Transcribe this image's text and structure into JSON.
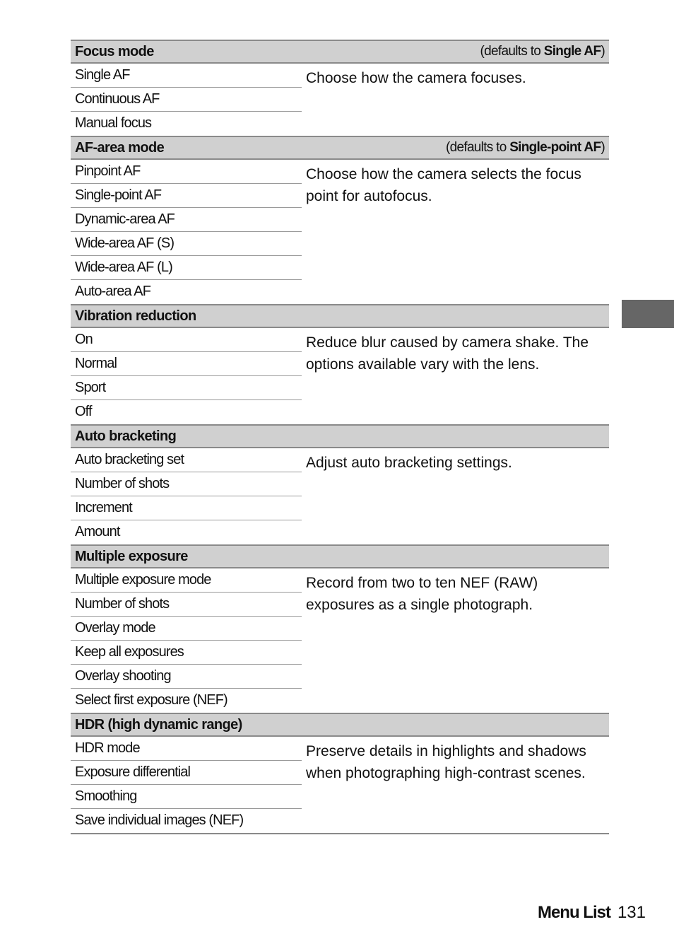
{
  "sections": [
    {
      "title": "Focus mode",
      "default_prefix": "(defaults to ",
      "default_value": "Single AF",
      "default_suffix": ")",
      "options": [
        "Single AF",
        "Continuous AF",
        "Manual focus"
      ],
      "description": "Choose how the camera focuses."
    },
    {
      "title": "AF-area mode",
      "default_prefix": "(defaults to ",
      "default_value": "Single-point AF",
      "default_suffix": ")",
      "options": [
        "Pinpoint AF",
        "Single-point AF",
        "Dynamic-area AF",
        "Wide-area AF (S)",
        "Wide-area AF (L)",
        "Auto-area AF"
      ],
      "description": "Choose how the camera selects the focus point for autofocus."
    },
    {
      "title": "Vibration reduction",
      "options": [
        "On",
        "Normal",
        "Sport",
        "Off"
      ],
      "description": "Reduce blur caused by camera shake. The options available vary with the lens."
    },
    {
      "title": "Auto bracketing",
      "options": [
        "Auto bracketing set",
        "Number of shots",
        "Increment",
        "Amount"
      ],
      "description": "Adjust auto bracketing settings."
    },
    {
      "title": "Multiple exposure",
      "options": [
        "Multiple exposure mode",
        "Number of shots",
        "Overlay mode",
        "Keep all exposures",
        "Overlay shooting",
        "Select first exposure (NEF)"
      ],
      "description": "Record from two to ten NEF (RAW) exposures as a single photograph."
    },
    {
      "title": "HDR (high dynamic range)",
      "options": [
        "HDR mode",
        "Exposure differential",
        "Smoothing",
        "Save individual images (NEF)"
      ],
      "description": "Preserve details in highlights and shadows when photographing high-contrast scenes."
    }
  ],
  "footer": {
    "section_label": "Menu List",
    "page_number": "131"
  },
  "colors": {
    "header_bg": "#d0d0d0",
    "rule": "#8a8a8a",
    "tab_marker": "#666666"
  }
}
